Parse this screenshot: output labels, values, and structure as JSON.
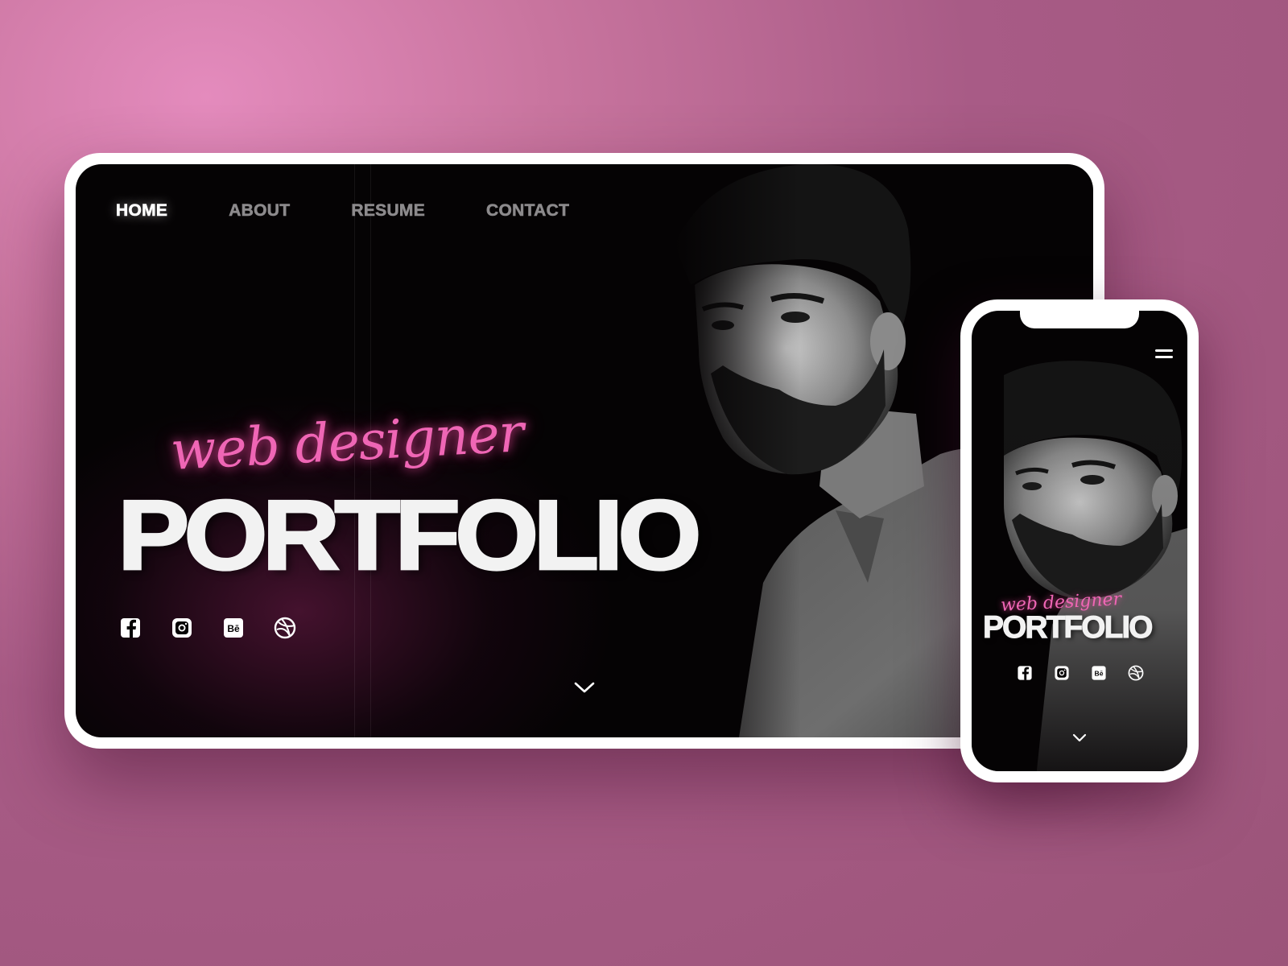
{
  "nav": {
    "items": [
      {
        "label": "HOME",
        "active": true
      },
      {
        "label": "ABOUT",
        "active": false
      },
      {
        "label": "RESUME",
        "active": false
      },
      {
        "label": "CONTACT",
        "active": false
      }
    ]
  },
  "hero": {
    "script_text": "web designer",
    "title": "PORTFOLIO"
  },
  "social": {
    "icons": [
      "facebook-icon",
      "instagram-icon",
      "behance-icon",
      "dribbble-icon"
    ],
    "behance_text": "Bē"
  },
  "phone": {
    "script_text": "web designer",
    "title": "PORTFOLIO"
  },
  "colors": {
    "accent_pink": "#ef66b5",
    "background": "#b0618f",
    "screen": "#050304"
  }
}
